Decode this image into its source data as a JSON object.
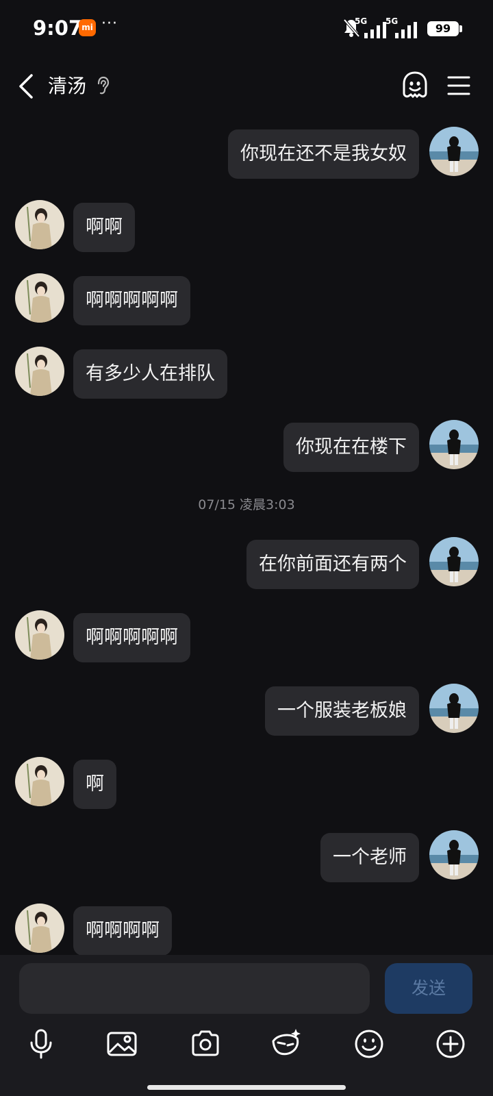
{
  "status_bar": {
    "time": "9:07",
    "mi_badge": "mi",
    "more": "···",
    "signal_1_label": "5G",
    "signal_2_label": "5G",
    "battery": "99"
  },
  "header": {
    "title": "清汤",
    "icons": [
      "back-icon",
      "ear-icon",
      "ghost-icon",
      "menu-icon"
    ]
  },
  "messages": [
    {
      "side": "out",
      "text": "你现在还不是我女奴"
    },
    {
      "side": "in",
      "text": "啊啊"
    },
    {
      "side": "in",
      "text": "啊啊啊啊啊"
    },
    {
      "side": "in",
      "text": "有多少人在排队"
    },
    {
      "side": "out",
      "text": "你现在在楼下"
    },
    {
      "side": "out",
      "text": "在你前面还有两个"
    },
    {
      "side": "in",
      "text": "啊啊啊啊啊"
    },
    {
      "side": "out",
      "text": "一个服装老板娘"
    },
    {
      "side": "in",
      "text": "啊"
    },
    {
      "side": "out",
      "text": "一个老师"
    },
    {
      "side": "in",
      "text": "啊啊啊啊"
    }
  ],
  "time_divider": "07/15 凌晨3:03",
  "input": {
    "value": "",
    "send_label": "发送"
  },
  "toolbar": [
    "microphone-icon",
    "image-icon",
    "camera-icon",
    "ai-effect-icon",
    "emoji-icon",
    "plus-icon"
  ],
  "colors": {
    "background": "#101013",
    "bubble": "#2a2a2e",
    "send_button": "#1e3b63",
    "mi_brand": "#ff6900"
  }
}
